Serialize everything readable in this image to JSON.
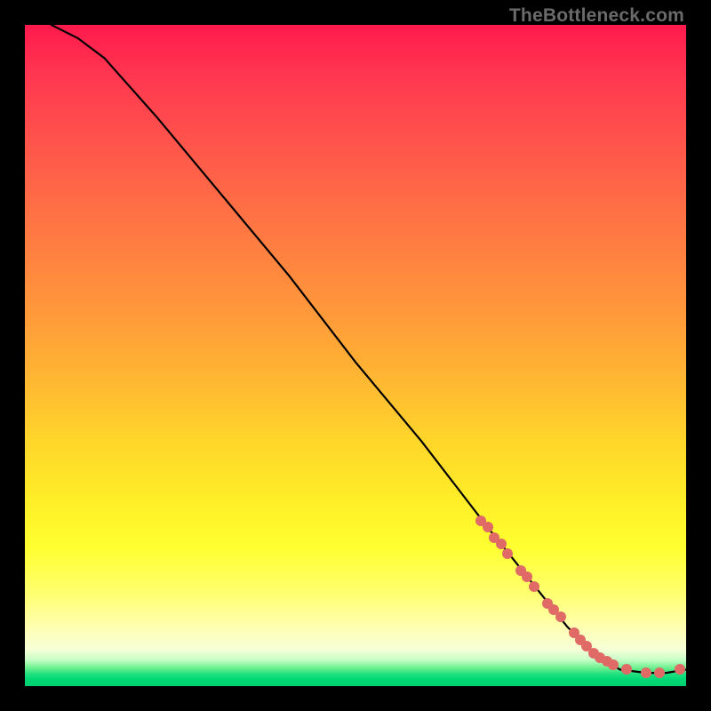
{
  "watermark": "TheBottleneck.com",
  "chart_data": {
    "type": "line",
    "title": "",
    "xlabel": "",
    "ylabel": "",
    "xlim": [
      0,
      100
    ],
    "ylim": [
      0,
      100
    ],
    "grid": false,
    "legend": false,
    "series": [
      {
        "name": "bottleneck-curve",
        "type": "line",
        "x": [
          4,
          8,
          12,
          20,
          30,
          40,
          50,
          60,
          70,
          74,
          78,
          82,
          86,
          90,
          94,
          97,
          100
        ],
        "y": [
          100,
          98,
          95,
          86,
          74,
          62,
          49,
          37,
          24,
          19,
          14,
          9,
          5,
          2.5,
          2,
          2,
          2.5
        ]
      },
      {
        "name": "highlight-segment",
        "type": "scatter",
        "x": [
          69,
          70,
          71,
          72,
          73,
          75,
          76,
          77,
          79,
          80,
          81,
          83,
          84,
          85,
          86,
          87,
          88,
          89,
          91,
          94,
          96,
          99
        ],
        "y": [
          25,
          24,
          22.5,
          21.5,
          20,
          17.5,
          16.5,
          15,
          12.5,
          11.5,
          10.5,
          8,
          7,
          6,
          5,
          4.3,
          3.7,
          3.2,
          2.5,
          2,
          2,
          2.5
        ]
      }
    ]
  }
}
